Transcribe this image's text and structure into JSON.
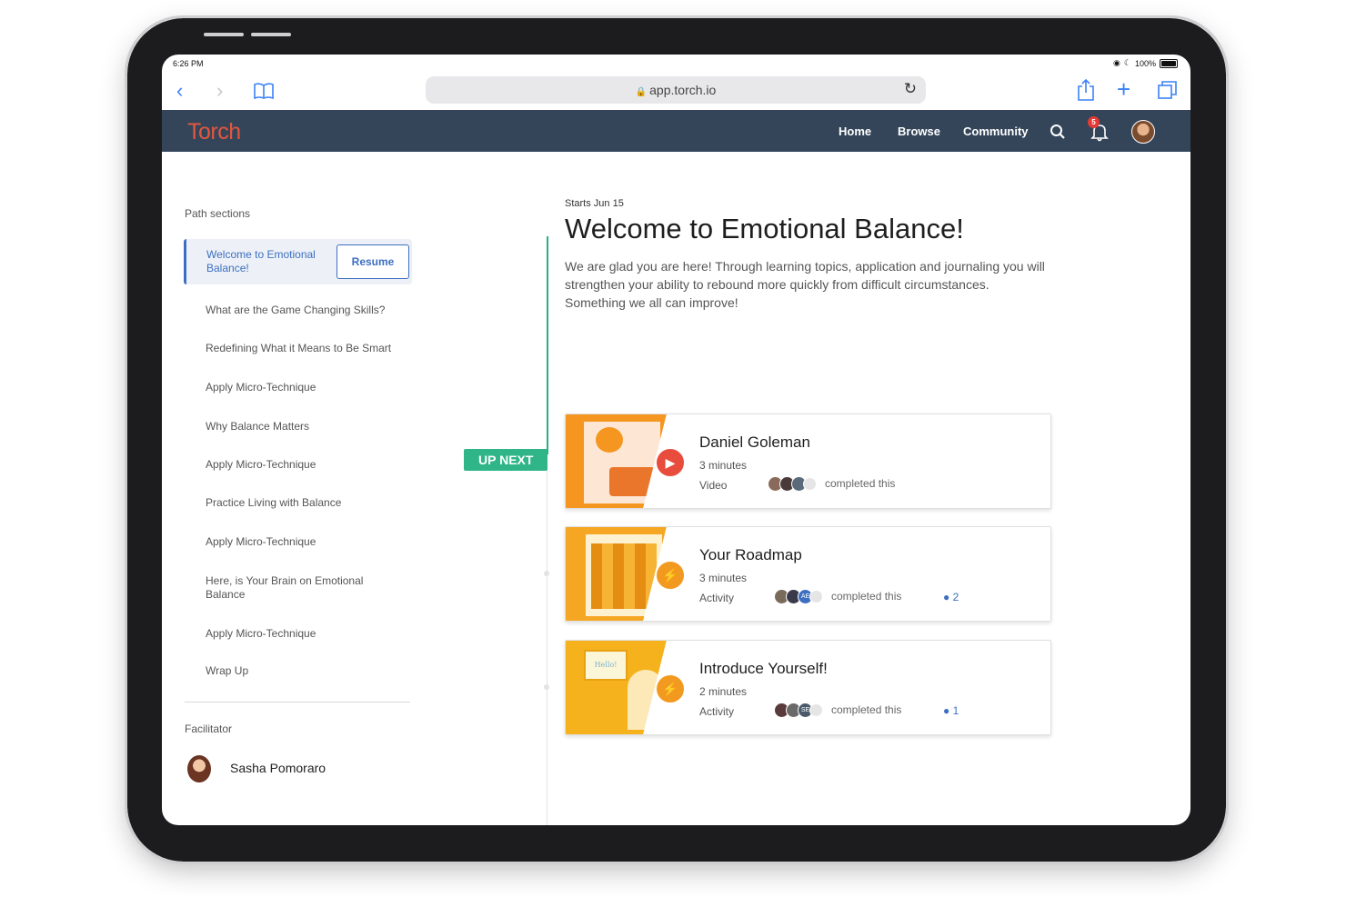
{
  "status_bar": {
    "time": "6:26 PM",
    "battery": "100%"
  },
  "browser": {
    "url": "app.torch.io"
  },
  "app": {
    "logo": "Torch",
    "nav": {
      "home": "Home",
      "browse": "Browse",
      "community": "Community"
    },
    "notification_count": "5"
  },
  "sidebar": {
    "heading": "Path sections",
    "active_item": "Welcome to Emotional Balance!",
    "resume_label": "Resume",
    "items": [
      "What are the Game Changing Skills?",
      "Redefining What it Means to Be Smart",
      "Apply Micro-Technique",
      "Why Balance Matters",
      "Apply Micro-Technique",
      "Practice Living with Balance",
      "Apply Micro-Technique",
      "Here, is Your Brain on Emotional Balance",
      "Apply Micro-Technique",
      "Wrap Up"
    ],
    "facilitator_heading": "Facilitator",
    "facilitator_name": "Sasha Pomoraro"
  },
  "timeline": {
    "up_next": "UP NEXT"
  },
  "main": {
    "date": "Starts Jun 15",
    "title": "Welcome to Emotional Balance!",
    "description": "We are glad you are here! Through learning topics, application and journaling you will strengthen your ability to rebound more quickly from difficult circumstances. Something we all can improve!",
    "cards": [
      {
        "title": "Daniel Goleman",
        "duration": "3 minutes",
        "type": "Video",
        "completed": "completed this",
        "comments": "",
        "avatar_initials": ""
      },
      {
        "title": "Your Roadmap",
        "duration": "3 minutes",
        "type": "Activity",
        "completed": "completed this",
        "comments": "2",
        "avatar_initials": "AE"
      },
      {
        "title": "Introduce Yourself!",
        "duration": "2 minutes",
        "type": "Activity",
        "completed": "completed this",
        "comments": "1",
        "avatar_initials": "SE",
        "speech_text": "Hello!"
      }
    ]
  },
  "colors": {
    "navbar": "#34455a",
    "logo": "#e3563e",
    "accent_blue": "#3d6fc1",
    "up_next_green": "#2fb587",
    "video_orange": "#f4961f",
    "activity_orange": "#f5a623"
  }
}
